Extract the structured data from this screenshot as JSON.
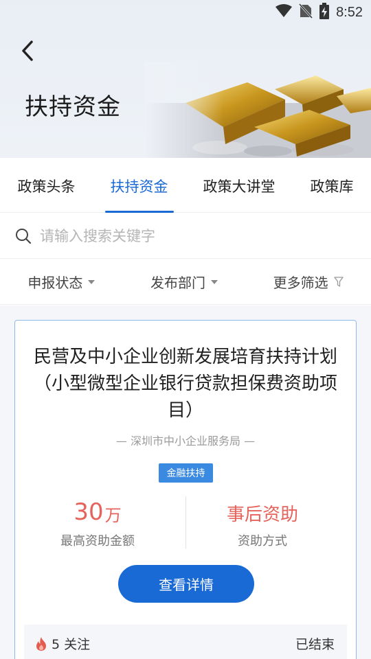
{
  "status_bar": {
    "time": "8:52"
  },
  "header": {
    "title": "扶持资金"
  },
  "tabs": [
    {
      "label": "政策头条"
    },
    {
      "label": "扶持资金"
    },
    {
      "label": "政策大讲堂"
    },
    {
      "label": "政策库"
    }
  ],
  "search": {
    "placeholder": "请输入搜索关键字"
  },
  "filters": [
    {
      "label": "申报状态"
    },
    {
      "label": "发布部门"
    },
    {
      "label": "更多筛选"
    }
  ],
  "card": {
    "title": "民营及中小企业创新发展培育扶持计划 （小型微型企业银行贷款担保费资助项目）",
    "department": "— 深圳市中小企业服务局 —",
    "tag": "金融扶持",
    "max_amount_value": "30",
    "max_amount_unit": "万",
    "max_amount_label": "最高资助金额",
    "funding_method_value": "事后资助",
    "funding_method_label": "资助方式",
    "detail_button": "查看详情",
    "follow_count": "5 关注",
    "status": "已结束"
  },
  "colors": {
    "accent": "#1a6ad6",
    "highlight": "#e5635b",
    "tag_bg": "#3b8ae2"
  }
}
